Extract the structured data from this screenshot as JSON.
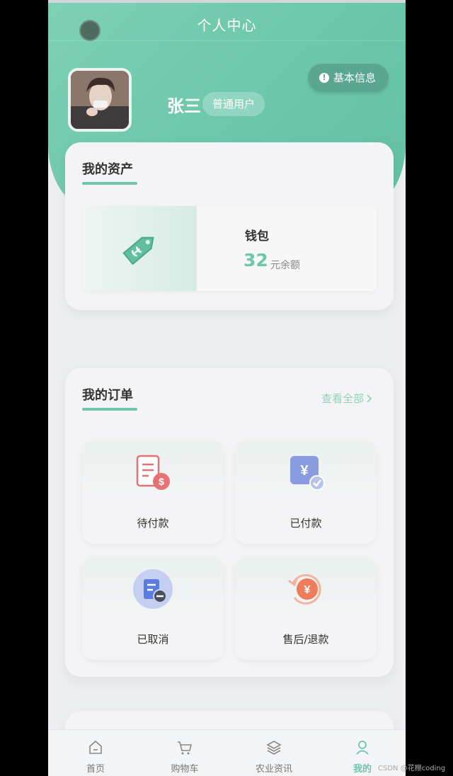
{
  "header": {
    "title": "个人中心",
    "username": "张三",
    "role": "普通用户",
    "info_button": "基本信息"
  },
  "assets": {
    "title": "我的资产",
    "wallet": {
      "name": "钱包",
      "amount": "32",
      "unit": "元余额"
    }
  },
  "orders": {
    "title": "我的订单",
    "view_all": "查看全部",
    "items": [
      {
        "label": "待付款",
        "icon": "pending-payment-icon"
      },
      {
        "label": "已付款",
        "icon": "paid-icon"
      },
      {
        "label": "已取消",
        "icon": "cancelled-icon"
      },
      {
        "label": "售后/退款",
        "icon": "refund-icon"
      }
    ]
  },
  "tabbar": {
    "tabs": [
      {
        "label": "首页",
        "icon": "home-icon"
      },
      {
        "label": "购物车",
        "icon": "cart-icon"
      },
      {
        "label": "农业资讯",
        "icon": "layers-icon"
      },
      {
        "label": "我的",
        "icon": "user-icon",
        "active": true
      }
    ]
  },
  "watermark": "CSDN @花棚coding",
  "colors": {
    "accent": "#6cc7ab",
    "pending": "#e57373",
    "paid": "#8a9ce0",
    "cancelled": "#5b7de0",
    "refund": "#ef7d5c"
  }
}
